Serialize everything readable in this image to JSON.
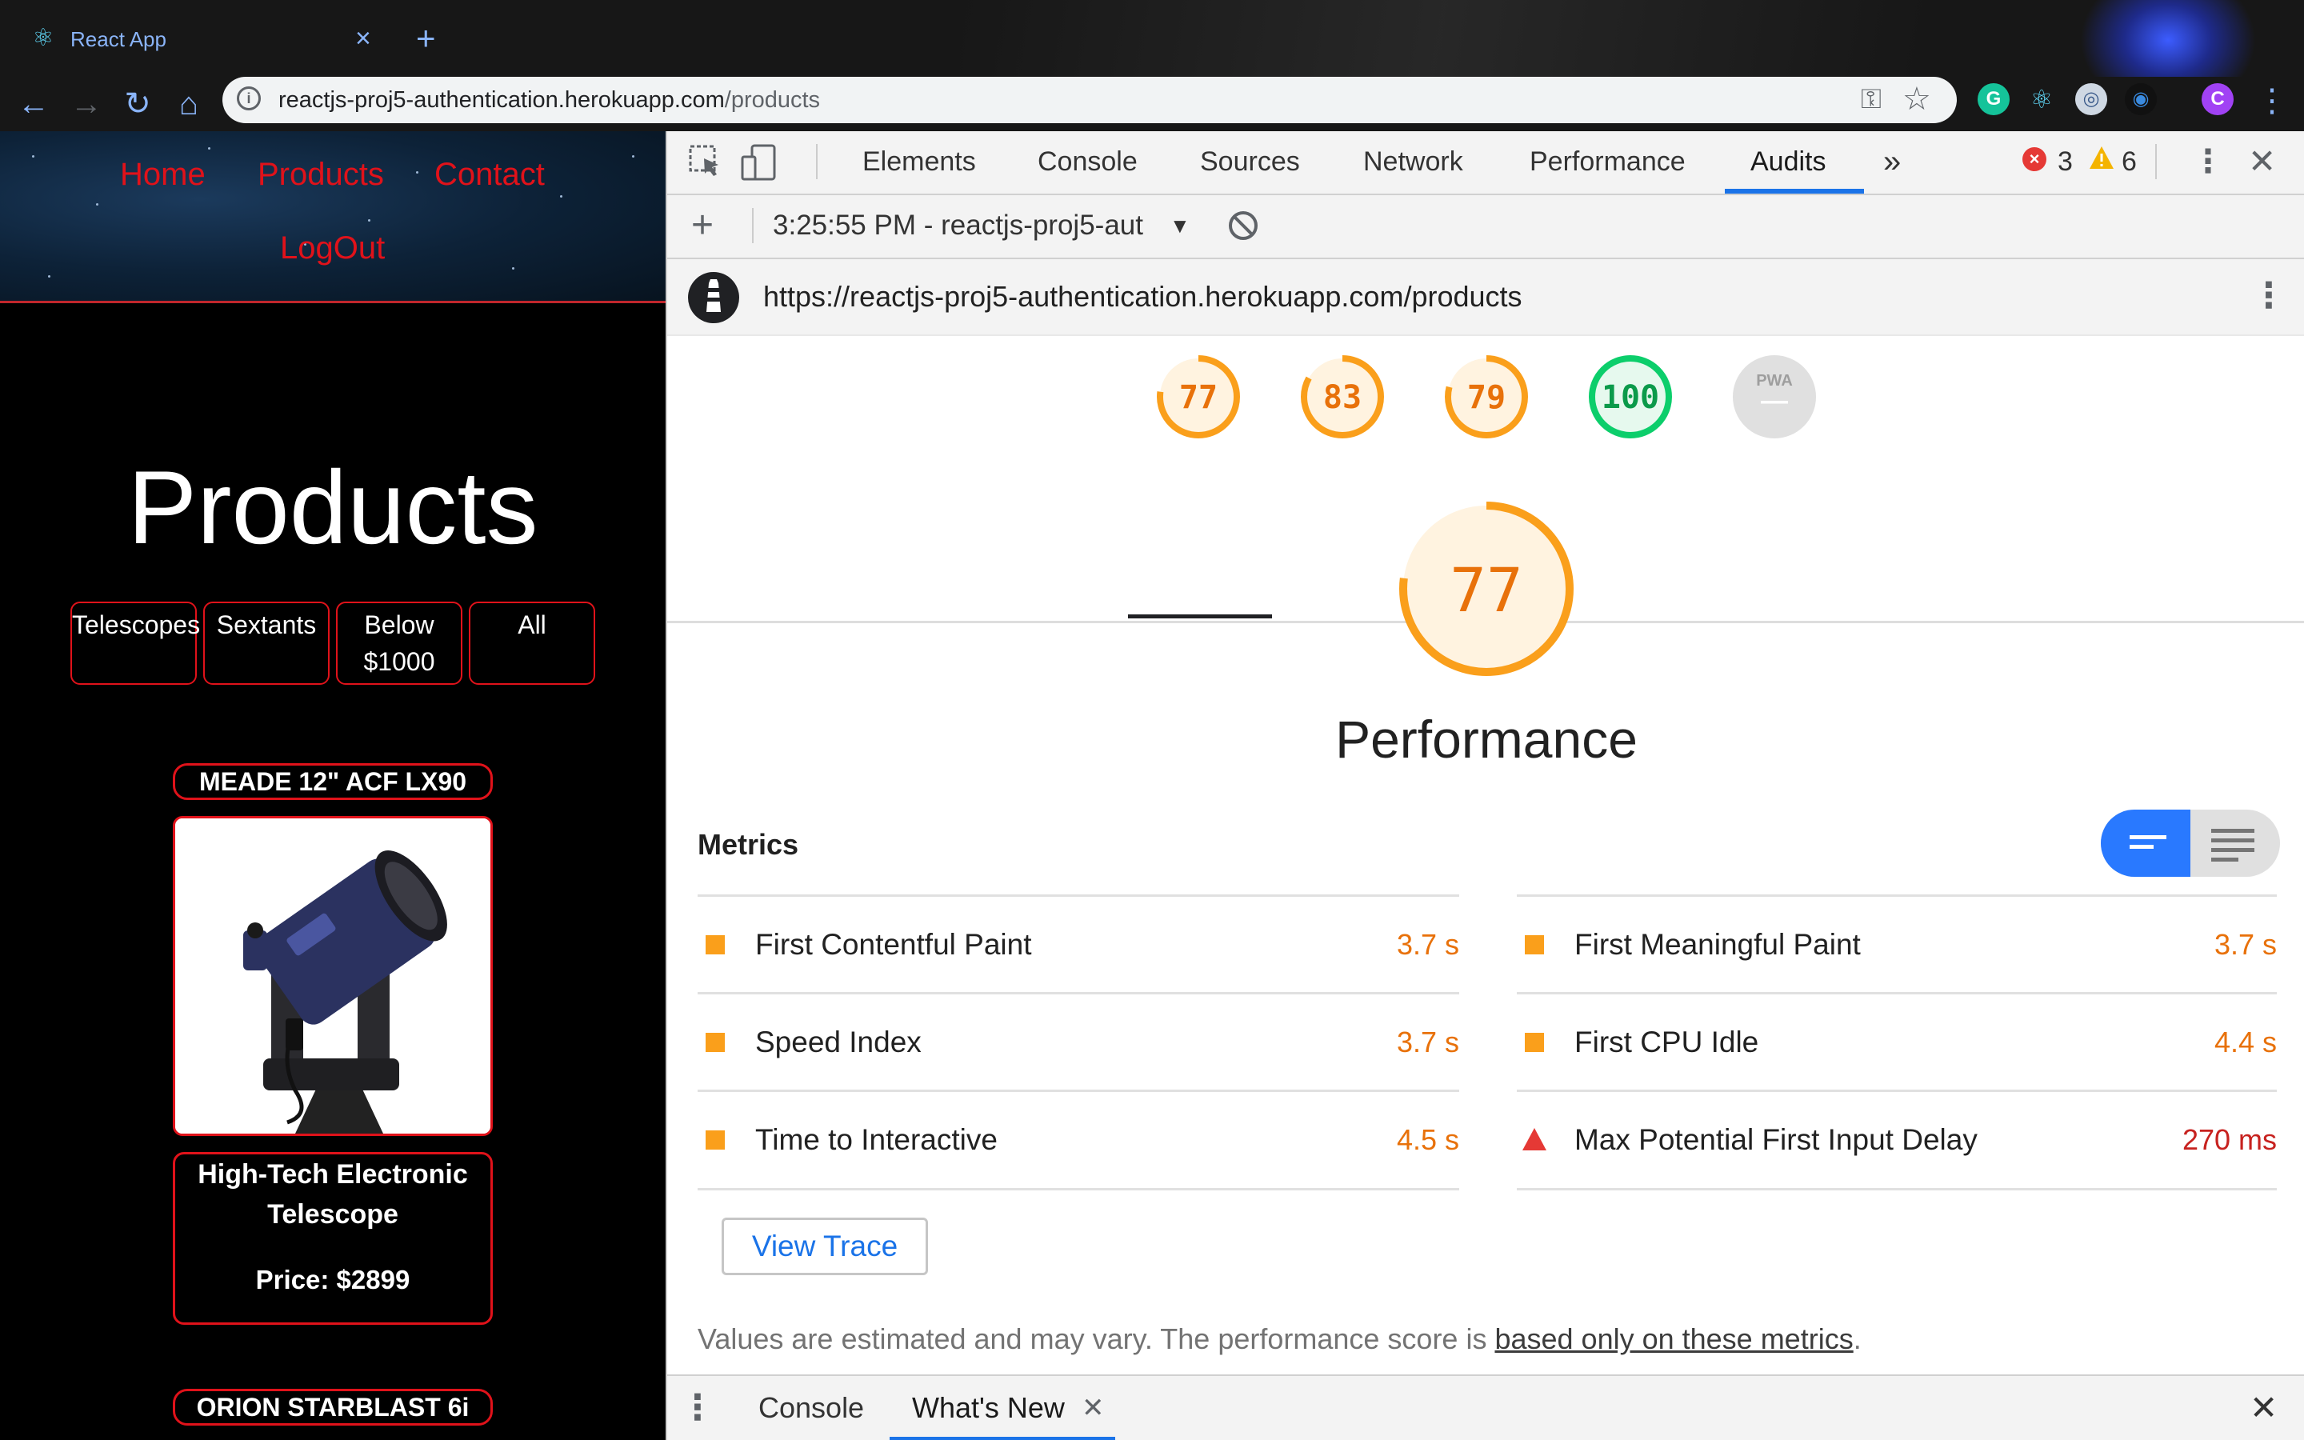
{
  "browser": {
    "tab_title": "React App",
    "tab_close": "×",
    "new_tab": "+",
    "url_host": "reactjs-proj5-authentication.herokuapp.com",
    "url_path": "/products",
    "profile_initial": "C"
  },
  "site": {
    "nav": [
      "Home",
      "Products",
      "Contact",
      "LogOut"
    ],
    "heading": "Products",
    "filters": [
      "Telescopes",
      "Sextants",
      "Below $1000",
      "All"
    ],
    "products": [
      {
        "name": "MEADE 12\" ACF LX90",
        "description": "High-Tech Electronic Telescope",
        "price": "Price: $2899"
      },
      {
        "name": "ORION STARBLAST 6i"
      }
    ]
  },
  "devtools": {
    "tabs": [
      "Elements",
      "Console",
      "Sources",
      "Network",
      "Performance",
      "Audits"
    ],
    "active_tab": "Audits",
    "more_tabs": "»",
    "errors": "3",
    "warnings": "6",
    "report_selector": "3:25:55 PM - reactjs-proj5-aut",
    "audit_url": "https://reactjs-proj5-authentication.herokuapp.com/products",
    "gauges": [
      {
        "score": "77",
        "value": 77,
        "color": "#fa9f1b",
        "track": "#fff3e0"
      },
      {
        "score": "83",
        "value": 83,
        "color": "#fa9f1b",
        "track": "#fff3e0"
      },
      {
        "score": "79",
        "value": 79,
        "color": "#fa9f1b",
        "track": "#fff3e0"
      },
      {
        "score": "100",
        "value": 100,
        "color": "#0cce6b",
        "track": "#e6f9ee"
      }
    ],
    "pwa_label": "PWA",
    "pwa_dash": "—",
    "main_score": "77",
    "main_value": 77,
    "category": "Performance",
    "metrics_title": "Metrics",
    "metrics_left": [
      {
        "label": "First Contentful Paint",
        "value": "3.7 s",
        "status": "average"
      },
      {
        "label": "Speed Index",
        "value": "3.7 s",
        "status": "average"
      },
      {
        "label": "Time to Interactive",
        "value": "4.5 s",
        "status": "average"
      }
    ],
    "metrics_right": [
      {
        "label": "First Meaningful Paint",
        "value": "3.7 s",
        "status": "average"
      },
      {
        "label": "First CPU Idle",
        "value": "4.4 s",
        "status": "average"
      },
      {
        "label": "Max Potential First Input Delay",
        "value": "270 ms",
        "status": "fail"
      }
    ],
    "view_trace": "View Trace",
    "disclaimer_text": "Values are estimated and may vary. The performance score is ",
    "disclaimer_link": "based only on these metrics",
    "disclaimer_end": ".",
    "drawer_tabs": [
      "Console",
      "What's New"
    ],
    "colors": {
      "average": "#fa9f1b",
      "average_text": "#e8710a",
      "fail": "#e53935",
      "pass": "#0cce6b",
      "accent": "#1a73e8"
    }
  }
}
